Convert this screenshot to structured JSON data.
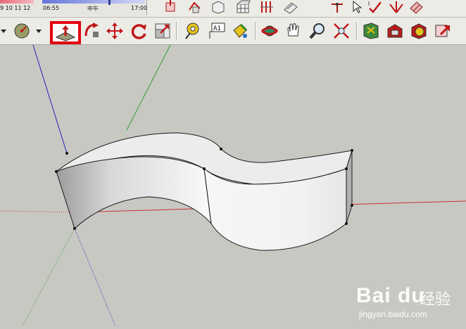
{
  "shadow_settings": {
    "month_labels": "9  10 11 12",
    "time_start": "06:55",
    "time_mid": "中午",
    "time_end": "17:00",
    "month_slider_color": "#e86a7b",
    "time_slider_color": "#6576d9"
  },
  "toolbar": {
    "selected_tool": "push-pull-tool",
    "highlight_color": "#e4000f",
    "tools": [
      "dropdown-arrow-icon",
      "circle-tool",
      "dropdown-arrow-icon",
      "push-pull-tool",
      "follow-me-tool",
      "move-tool",
      "rotate-tool",
      "scale-tool",
      "tape-measure-tool",
      "text-tool",
      "paint-bucket-tool",
      "orbit-tool",
      "pan-tool",
      "zoom-tool",
      "zoom-extents-tool",
      "component-tool",
      "warehouse-tool",
      "extension-tool",
      "share-model-tool"
    ]
  },
  "viewport": {
    "axis_colors": {
      "red": "#c83232",
      "green": "#2f9e2f",
      "blue": "#2222b8"
    }
  },
  "watermark": {
    "logo": "Bai du",
    "cn_text": "经验",
    "url": "jingyan.baidu.com"
  }
}
